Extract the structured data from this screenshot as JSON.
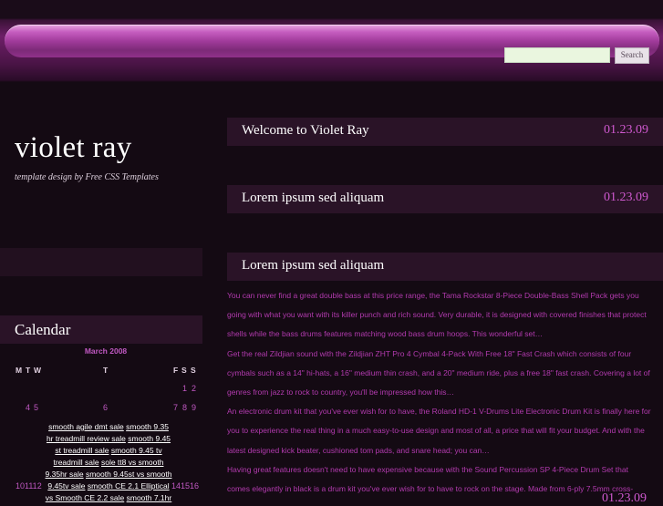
{
  "search": {
    "placeholder": "",
    "button_label": "Search"
  },
  "site": {
    "title": "violet ray",
    "tagline": "template design by Free CSS Templates"
  },
  "calendar": {
    "title": "Calendar",
    "month": "March 2008",
    "dow": {
      "m": "M",
      "t1": "T",
      "w": "W",
      "t2": "T",
      "f": "F",
      "s1": "S",
      "s2": "S"
    },
    "row1": {
      "sat": "1",
      "sun": "2"
    },
    "row2": {
      "mon": "4",
      "tue": "5",
      "fri": "6",
      "sat": "7",
      "sun": "8",
      "extra": "9"
    },
    "links": [
      "smooth agile dmt sale",
      "smooth 9.35",
      "hr treadmill review sale",
      "smooth 9.45",
      "st treadmill sale",
      "smooth 9.45 tv",
      "treadmill sale",
      "sole tt8 vs smooth",
      "9.35hr sale",
      "smooth 9.45st vs smooth",
      "9.45tv sale",
      "smooth CE 2.1 Elliptical",
      "vs Smooth CE 2.2 sale",
      "smooth 7.1hr"
    ],
    "side_left": "101112",
    "side_right": "141516"
  },
  "posts": [
    {
      "title": "Welcome to Violet Ray",
      "date": "01.23.09"
    },
    {
      "title": "Lorem ipsum sed aliquam",
      "date": "01.23.09"
    },
    {
      "title": "Lorem ipsum sed aliquam",
      "date": ""
    }
  ],
  "post_body_lines": [
    "You can never find a great double bass at this price range, the Tama Rockstar 8-Piece Double-Bass Shell Pack gets you",
    "going with what you want with its killer punch and rich sound. Very durable, it is designed with covered finishes that protect",
    "shells while the bass drums features matching wood bass drum hoops. This wonderful set…",
    "Get the real Zildjian sound with the Zildjian ZHT Pro 4 Cymbal 4-Pack With Free 18\" Fast Crash which consists of four",
    "cymbals such as a 14\" hi-hats, a 16\" medium thin crash, and a 20\" medium ride, plus a free 18\" fast crash. Covering a lot of",
    "genres from jazz to rock to country, you'll be impressed how this…",
    "An electronic drum kit that you've ever wish for to have, the Roland HD-1 V-Drums Lite Electronic Drum Kit is finally here for",
    "you to experience the real thing in a much easy-to-use design and most of all, a price that will fit your budget. And with the",
    "latest designed kick beater, cushioned tom pads, and snare head; you can…",
    "Having great features doesn't need to have expensive because with the Sound Percussion SP 4-Piece Drum Set that",
    "comes elegantly in black is a drum kit you've ever wish for to have to rock on the stage. Made from 6-ply 7.5mm cross-"
  ],
  "bottom_date": "01.23.09"
}
